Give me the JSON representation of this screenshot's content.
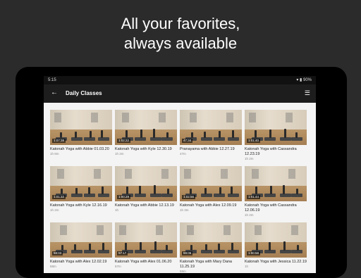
{
  "promo": {
    "line1": "All your favorites,",
    "line2": "always available"
  },
  "status": {
    "time": "5:15",
    "battery": "90%"
  },
  "appbar": {
    "title": "Daily Classes"
  },
  "icons": {
    "back": "back-arrow-icon",
    "filter": "filter-icon"
  },
  "videos": [
    {
      "title": "Katonah Yoga with Abbie 01.03.20",
      "duration": "1:07:38",
      "sub": "1h 8m"
    },
    {
      "title": "Katonah Yoga with Kyle 12.30.19",
      "duration": "1:02:22",
      "sub": "1h 2m"
    },
    {
      "title": "Pranayama with Abbie 12.27.19",
      "duration": "47:34",
      "sub": "47m"
    },
    {
      "title": "Katonah Yoga with Cassandra 12.23.19",
      "duration": "1:01:40",
      "sub": "1h 2m"
    },
    {
      "title": "Katonah Yoga with Kyle 12.16.19",
      "duration": "1:01:32",
      "sub": "1h 2m"
    },
    {
      "title": "Katonah Yoga with Abbie 12.13.19",
      "duration": "1:00:29",
      "sub": "1h"
    },
    {
      "title": "Katonah Yoga with Alex 12.09.19",
      "duration": "1:02:56",
      "sub": "1h 3m"
    },
    {
      "title": "Katonah Yoga with Cassandra 12.06.19",
      "duration": "1:01:44",
      "sub": "1h 2m"
    },
    {
      "title": "Katonah Yoga with Alex 12.02.19",
      "duration": "58:03",
      "sub": "58m"
    },
    {
      "title": "Katonah Yoga with Alex 01.06.20",
      "duration": "57:17",
      "sub": "57m"
    },
    {
      "title": "Katonah Yoga with Mary Dana 11.25.19",
      "duration": "59:06",
      "sub": "59m"
    },
    {
      "title": "Katonah Yoga with Jessica 11.22.19",
      "duration": "1:00:58",
      "sub": "1h"
    }
  ]
}
